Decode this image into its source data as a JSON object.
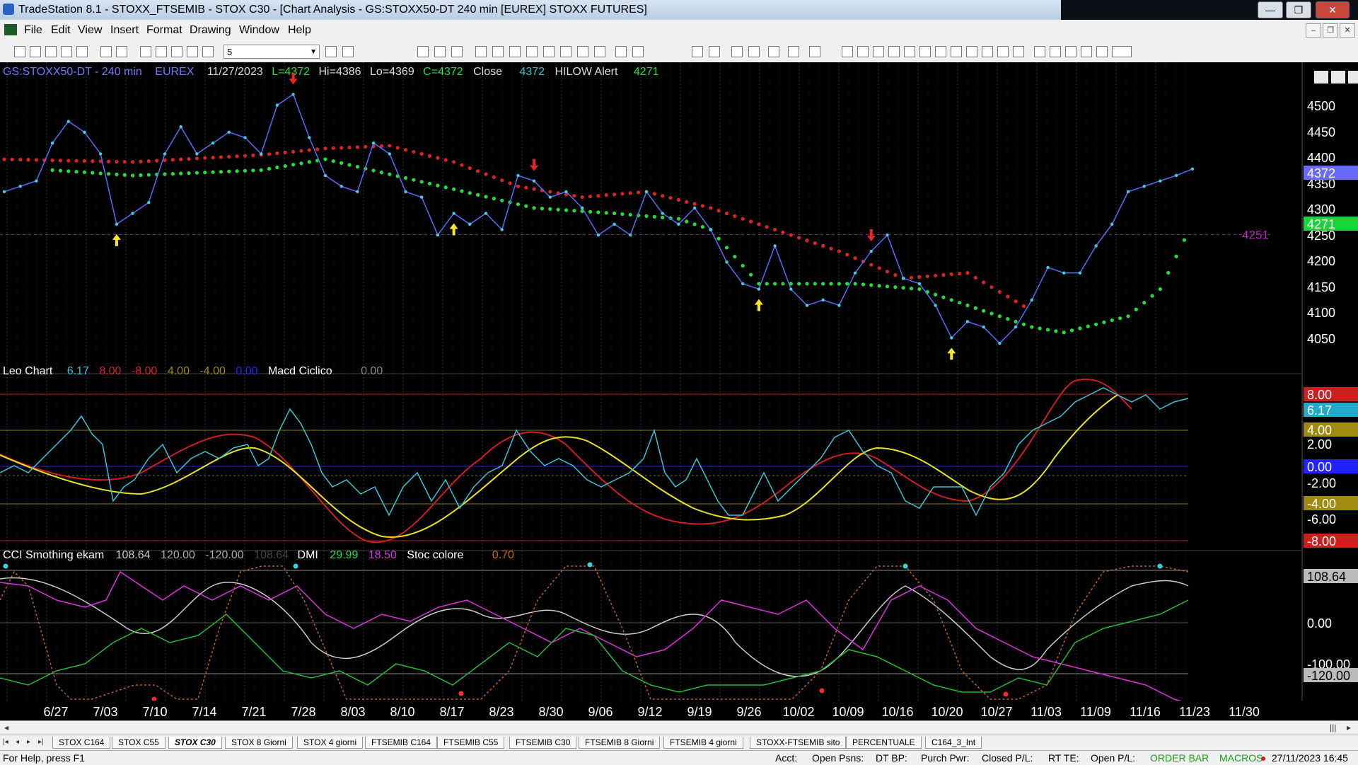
{
  "window": {
    "title": "TradeStation 8.1 - STOXX_FTSEMIB - STOX  C30 - [Chart Analysis - GS:STOXX50-DT  240 min  [EUREX] STOXX FUTURES]",
    "min": "—",
    "max": "❐",
    "close": "✕"
  },
  "menu": {
    "items": [
      "File",
      "Edit",
      "View",
      "Insert",
      "Format",
      "Drawing",
      "Window",
      "Help"
    ],
    "mdi": [
      "–",
      "❐",
      "✕"
    ]
  },
  "toolbar": {
    "combo_value": "5"
  },
  "price_header": {
    "symbol": "GS:STOXX50-DT - 240 min",
    "exchange": "EUREX",
    "date": "11/27/2023",
    "last": "L=4372",
    "hi": "Hi=4386",
    "lo": "Lo=4369",
    "close_val": "C=4372",
    "close_label": "Close",
    "close_num": "4372",
    "alert_label": "HILOW Alert",
    "alert_num": "4271"
  },
  "leo_header": {
    "name": "Leo Chart",
    "v1": "6.17",
    "v2": "8.00",
    "v3": "-8.00",
    "v4": "4.00",
    "v5": "-4.00",
    "v6": "0.00",
    "name2": "Macd Ciclico",
    "v7": "0.00"
  },
  "cci_header": {
    "name": "CCI Smothing ekam",
    "v1": "108.64",
    "v2": "120.00",
    "v3": "-120.00",
    "v4": "108.64",
    "dmi": "DMI",
    "dmi1": "29.99",
    "dmi2": "18.50",
    "stoc": "Stoc colore",
    "stoc_v": "0.70"
  },
  "price_axis": {
    "labels": [
      "4500",
      "4450",
      "4400",
      "4350",
      "4300",
      "4250",
      "4200",
      "4150",
      "4100",
      "4050"
    ],
    "last_badge": "4372",
    "alert_badge": "4271",
    "line_label": "4251"
  },
  "leo_axis": {
    "labels": [
      "2.00",
      "-2.00",
      "-6.00"
    ],
    "badges": [
      "8.00",
      "6.17",
      "4.00",
      "0.00",
      "-4.00",
      "-8.00"
    ]
  },
  "cci_axis": {
    "labels": [
      "0.00",
      "-100.00"
    ],
    "badges": [
      "108.64",
      "-120.00"
    ]
  },
  "date_axis": [
    "6/27",
    "7/03",
    "7/10",
    "7/14",
    "7/21",
    "7/28",
    "8/03",
    "8/10",
    "8/17",
    "8/23",
    "8/30",
    "9/06",
    "9/12",
    "9/19",
    "9/26",
    "10/02",
    "10/09",
    "10/16",
    "10/20",
    "10/27",
    "11/03",
    "11/09",
    "11/16",
    "11/23",
    "11/30"
  ],
  "chart_data": {
    "type": "line",
    "symbol": "GS:STOXX50-DT",
    "interval": "240 min",
    "ylim": [
      4020,
      4530
    ],
    "price_series": [
      {
        "t": 0,
        "v": 4330
      },
      {
        "t": 1,
        "v": 4340
      },
      {
        "t": 2,
        "v": 4350
      },
      {
        "t": 3,
        "v": 4420
      },
      {
        "t": 4,
        "v": 4460
      },
      {
        "t": 5,
        "v": 4440
      },
      {
        "t": 6,
        "v": 4400
      },
      {
        "t": 7,
        "v": 4270
      },
      {
        "t": 8,
        "v": 4290
      },
      {
        "t": 9,
        "v": 4310
      },
      {
        "t": 10,
        "v": 4400
      },
      {
        "t": 11,
        "v": 4450
      },
      {
        "t": 12,
        "v": 4400
      },
      {
        "t": 13,
        "v": 4420
      },
      {
        "t": 14,
        "v": 4440
      },
      {
        "t": 15,
        "v": 4430
      },
      {
        "t": 16,
        "v": 4400
      },
      {
        "t": 17,
        "v": 4490
      },
      {
        "t": 18,
        "v": 4510
      },
      {
        "t": 19,
        "v": 4430
      },
      {
        "t": 20,
        "v": 4360
      },
      {
        "t": 21,
        "v": 4340
      },
      {
        "t": 22,
        "v": 4330
      },
      {
        "t": 23,
        "v": 4420
      },
      {
        "t": 24,
        "v": 4400
      },
      {
        "t": 25,
        "v": 4330
      },
      {
        "t": 26,
        "v": 4320
      },
      {
        "t": 27,
        "v": 4250
      },
      {
        "t": 28,
        "v": 4290
      },
      {
        "t": 29,
        "v": 4270
      },
      {
        "t": 30,
        "v": 4290
      },
      {
        "t": 31,
        "v": 4260
      },
      {
        "t": 32,
        "v": 4360
      },
      {
        "t": 33,
        "v": 4350
      },
      {
        "t": 34,
        "v": 4320
      },
      {
        "t": 35,
        "v": 4330
      },
      {
        "t": 36,
        "v": 4300
      },
      {
        "t": 37,
        "v": 4250
      },
      {
        "t": 38,
        "v": 4270
      },
      {
        "t": 39,
        "v": 4250
      },
      {
        "t": 40,
        "v": 4330
      },
      {
        "t": 41,
        "v": 4290
      },
      {
        "t": 42,
        "v": 4270
      },
      {
        "t": 43,
        "v": 4300
      },
      {
        "t": 44,
        "v": 4260
      },
      {
        "t": 45,
        "v": 4200
      },
      {
        "t": 46,
        "v": 4160
      },
      {
        "t": 47,
        "v": 4150
      },
      {
        "t": 48,
        "v": 4230
      },
      {
        "t": 49,
        "v": 4150
      },
      {
        "t": 50,
        "v": 4120
      },
      {
        "t": 51,
        "v": 4130
      },
      {
        "t": 52,
        "v": 4120
      },
      {
        "t": 53,
        "v": 4180
      },
      {
        "t": 54,
        "v": 4220
      },
      {
        "t": 55,
        "v": 4250
      },
      {
        "t": 56,
        "v": 4170
      },
      {
        "t": 57,
        "v": 4160
      },
      {
        "t": 58,
        "v": 4120
      },
      {
        "t": 59,
        "v": 4060
      },
      {
        "t": 60,
        "v": 4090
      },
      {
        "t": 61,
        "v": 4080
      },
      {
        "t": 62,
        "v": 4050
      },
      {
        "t": 63,
        "v": 4080
      },
      {
        "t": 64,
        "v": 4130
      },
      {
        "t": 65,
        "v": 4190
      },
      {
        "t": 66,
        "v": 4180
      },
      {
        "t": 67,
        "v": 4180
      },
      {
        "t": 68,
        "v": 4230
      },
      {
        "t": 69,
        "v": 4270
      },
      {
        "t": 70,
        "v": 4330
      },
      {
        "t": 71,
        "v": 4340
      },
      {
        "t": 72,
        "v": 4350
      },
      {
        "t": 73,
        "v": 4360
      },
      {
        "t": 74,
        "v": 4372
      }
    ],
    "red_trail": [
      [
        0,
        4390
      ],
      [
        8,
        4385
      ],
      [
        16,
        4398
      ],
      [
        20,
        4410
      ],
      [
        24,
        4415
      ],
      [
        28,
        4385
      ],
      [
        32,
        4340
      ],
      [
        36,
        4320
      ],
      [
        40,
        4330
      ],
      [
        44,
        4300
      ],
      [
        48,
        4260
      ],
      [
        52,
        4220
      ],
      [
        56,
        4170
      ],
      [
        60,
        4180
      ],
      [
        64,
        4110
      ]
    ],
    "green_trail": [
      [
        3,
        4370
      ],
      [
        8,
        4360
      ],
      [
        16,
        4370
      ],
      [
        20,
        4390
      ],
      [
        33,
        4300
      ],
      [
        38,
        4290
      ],
      [
        42,
        4280
      ],
      [
        44,
        4260
      ],
      [
        47,
        4160
      ],
      [
        53,
        4160
      ],
      [
        57,
        4150
      ],
      [
        64,
        4080
      ],
      [
        66,
        4070
      ],
      [
        70,
        4100
      ],
      [
        72,
        4150
      ],
      [
        74,
        4271
      ]
    ],
    "down_arrows": [
      18,
      33,
      54
    ],
    "up_arrows": [
      7,
      28,
      47,
      59
    ]
  }
}
